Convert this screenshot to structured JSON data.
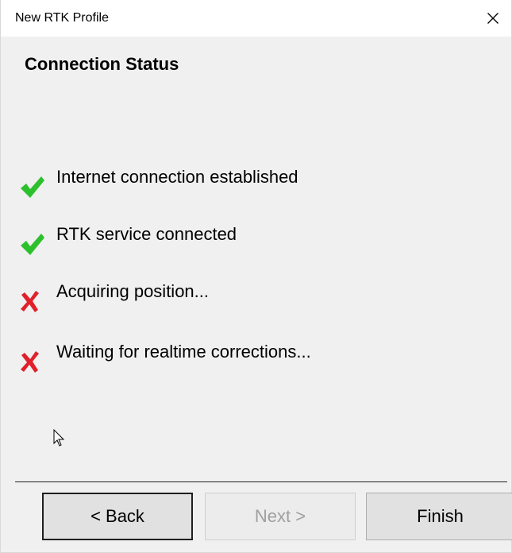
{
  "window": {
    "title": "New RTK Profile"
  },
  "heading": "Connection Status",
  "statuses": [
    {
      "label": "Internet connection established",
      "state": "ok"
    },
    {
      "label": "RTK service connected",
      "state": "ok"
    },
    {
      "label": "Acquiring position...",
      "state": "pending"
    },
    {
      "label": "Waiting for realtime corrections...",
      "state": "pending"
    }
  ],
  "buttons": {
    "back": "< Back",
    "next": "Next >",
    "finish": "Finish"
  },
  "icons": {
    "ok": "checkmark-icon",
    "pending": "x-mark-icon",
    "close": "close-icon"
  },
  "colors": {
    "ok": "#2cc12c",
    "pending": "#e0202a"
  }
}
